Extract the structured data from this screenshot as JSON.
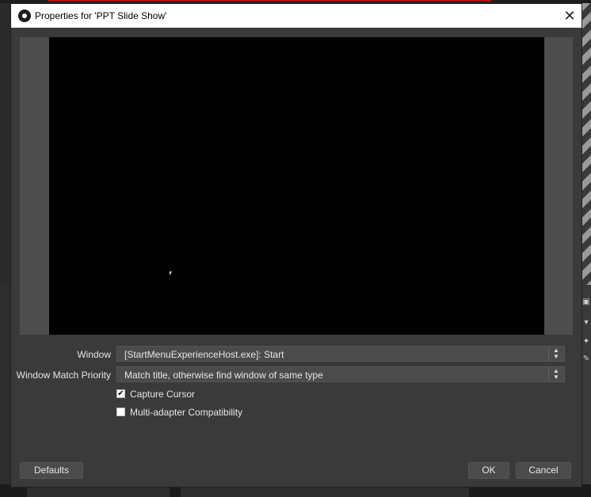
{
  "dialog": {
    "title": "Properties for 'PPT Slide Show'",
    "close_icon": "close-icon",
    "logo_icon": "obs-logo-icon"
  },
  "properties": {
    "window": {
      "label": "Window",
      "value": "[StartMenuExperienceHost.exe]: Start"
    },
    "match_priority": {
      "label": "Window Match Priority",
      "value": "Match title, otherwise find window of same type"
    },
    "capture_cursor": {
      "label": "Capture Cursor",
      "checked": true
    },
    "multi_adapter": {
      "label": "Multi-adapter Compatibility",
      "checked": false
    }
  },
  "buttons": {
    "defaults": "Defaults",
    "ok": "OK",
    "cancel": "Cancel"
  },
  "colors": {
    "dialog_bg": "#3a3a3a",
    "preview_bg": "#000000",
    "control_bg": "#4b4b4b"
  }
}
